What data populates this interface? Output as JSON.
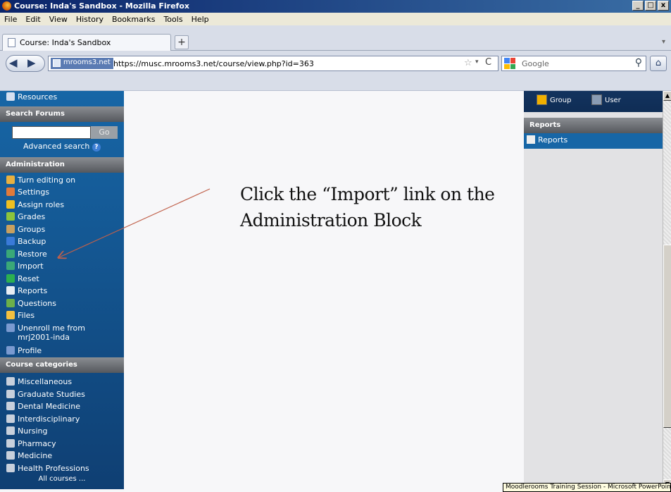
{
  "window": {
    "title": "Course: Inda's Sandbox - Mozilla Firefox",
    "buttons": [
      "_",
      "□",
      "x"
    ]
  },
  "menu": [
    {
      "label": "File",
      "key": "F"
    },
    {
      "label": "Edit",
      "key": "E"
    },
    {
      "label": "View",
      "key": "V"
    },
    {
      "label": "History",
      "key": "s"
    },
    {
      "label": "Bookmarks",
      "key": "B"
    },
    {
      "label": "Tools",
      "key": "T"
    },
    {
      "label": "Help",
      "key": "H"
    }
  ],
  "tab": {
    "title": "Course: Inda's Sandbox",
    "new_tab": "+",
    "overflow": "▾"
  },
  "nav": {
    "site_id": "mrooms3.net",
    "url": "https://musc.mrooms3.net/course/view.php?id=363",
    "search_placeholder": "Google",
    "back": "◀",
    "forward": "▶",
    "reload": "C",
    "star": "☆",
    "drop": "▾",
    "home": "⌂",
    "search_go": "⚲"
  },
  "left": {
    "resources_label": "Resources",
    "search_forums": {
      "header": "Search Forums",
      "go": "Go",
      "advanced": "Advanced search",
      "help": "?"
    },
    "administration": {
      "header": "Administration",
      "items": [
        {
          "label": "Turn editing on",
          "icon": "pencil-icon"
        },
        {
          "label": "Settings",
          "icon": "settings-icon"
        },
        {
          "label": "Assign roles",
          "icon": "roles-icon"
        },
        {
          "label": "Grades",
          "icon": "grades-icon"
        },
        {
          "label": "Groups",
          "icon": "groups-icon"
        },
        {
          "label": "Backup",
          "icon": "backup-icon"
        },
        {
          "label": "Restore",
          "icon": "restore-icon"
        },
        {
          "label": "Import",
          "icon": "import-icon"
        },
        {
          "label": "Reset",
          "icon": "reset-icon"
        },
        {
          "label": "Reports",
          "icon": "reports-icon"
        },
        {
          "label": "Questions",
          "icon": "questions-icon"
        },
        {
          "label": "Files",
          "icon": "folder-icon"
        },
        {
          "label": "Unenroll me from mrj2001-inda",
          "icon": "unenroll-icon"
        },
        {
          "label": "Profile",
          "icon": "profile-icon"
        }
      ]
    },
    "categories": {
      "header": "Course categories",
      "items": [
        "Miscellaneous",
        "Graduate Studies",
        "Dental Medicine",
        "Interdisciplinary",
        "Nursing",
        "Pharmacy",
        "Medicine",
        "Health Professions"
      ],
      "all": "All courses ..."
    }
  },
  "main": {
    "instruction_line1": "Click the “Import” link on the",
    "instruction_line2": "Administration Block"
  },
  "right": {
    "group": "Group",
    "user": "User",
    "reports_header": "Reports",
    "reports_link": "Reports"
  },
  "taskbar": "Moodlerooms Training Session - Microsoft PowerPoint",
  "colors": {
    "arrow": "#c0604a",
    "nav_blue": "#1766a6",
    "header_gray": "#6a6d72"
  }
}
